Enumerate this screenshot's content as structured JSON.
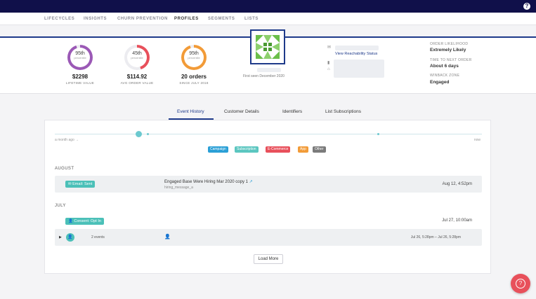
{
  "topbar": {
    "help_glyph": "?"
  },
  "nav": {
    "items": [
      "LIFECYCLES",
      "INSIGHTS",
      "CHURN PREVENTION",
      "PROFILES",
      "SEGMENTS",
      "LISTS"
    ],
    "active": "PROFILES"
  },
  "metrics": [
    {
      "pct": "95th",
      "sub": "percentile",
      "value": "$2298",
      "label": "LIFETIME VALUE",
      "color": "#9b59b6",
      "fill": 0.95
    },
    {
      "pct": "45th",
      "sub": "percentile",
      "value": "$114.92",
      "label": "AVG ORDER VALUE",
      "color": "#e8505b",
      "fill": 0.45
    },
    {
      "pct": "95th",
      "sub": "percentile",
      "value": "20 orders",
      "label": "SINCE JULY 2018",
      "color": "#f29b38",
      "fill": 0.95
    }
  ],
  "profile": {
    "first_seen": "First seen December 2020",
    "reachability_link": "View Reachability Status"
  },
  "side": {
    "order_likelihood_label": "ORDER LIKELIHOOD",
    "order_likelihood_value": "Extremely Likely",
    "time_to_next_label": "TIME TO NEXT ORDER",
    "time_to_next_value": "About 6 days",
    "winback_label": "WINBACK ZONE",
    "winback_value": "Engaged"
  },
  "tabs": [
    "Event History",
    "Customer Details",
    "Identifiers",
    "List Subscriptions"
  ],
  "timeline": {
    "left_label": "a month ago →",
    "right_label": "now"
  },
  "legend": [
    {
      "label": "Campaign",
      "color": "#2a9fd6"
    },
    {
      "label": "Subscription",
      "color": "#5bc6c0"
    },
    {
      "label": "E-Commerce",
      "color": "#e8505b"
    },
    {
      "label": "App",
      "color": "#f29b38"
    },
    {
      "label": "Other",
      "color": "#7b7b7b"
    }
  ],
  "events": {
    "august_label": "AUGUST",
    "email_badge": "Email: Sent",
    "email_title": "Engaged Base Were Hiring Mar 2020 copy 1",
    "email_sub": "hiring_message_a",
    "email_date": "Aug 12, 4:52pm",
    "july_label": "JULY",
    "consent_badge": "Consent: Opt In",
    "consent_date": "Jul 27, 10:00am",
    "group_count": "2 events",
    "group_range": "Jul 26, 5:28pm – Jul 26, 5:28pm"
  },
  "load_more": "Load More"
}
